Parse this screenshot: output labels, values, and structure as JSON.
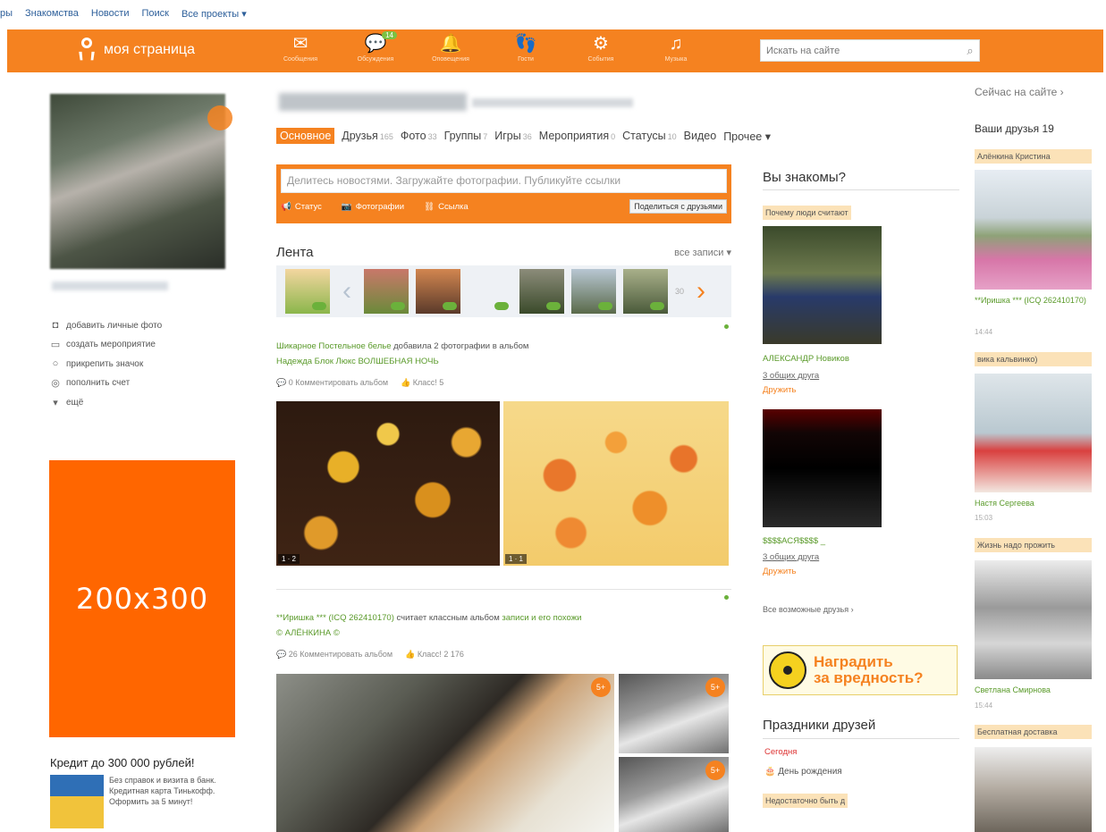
{
  "toplinks": [
    "ры",
    "Знакомства",
    "Новости",
    "Поиск",
    "Все проекты ▾"
  ],
  "header": {
    "logo_text": "моя страница",
    "nav": [
      {
        "icon": "envelope-icon",
        "glyph": "✉",
        "label": "Сообщения",
        "badge": ""
      },
      {
        "icon": "discussions-icon",
        "glyph": "💬",
        "label": "Обсуждения",
        "badge": "14"
      },
      {
        "icon": "bell-icon",
        "glyph": "🔔",
        "label": "Оповещения",
        "badge": ""
      },
      {
        "icon": "guests-icon",
        "glyph": "👣",
        "label": "Гости",
        "badge": ""
      },
      {
        "icon": "events-icon",
        "glyph": "⚙",
        "label": "События",
        "badge": ""
      },
      {
        "icon": "music-icon",
        "glyph": "♫",
        "label": "Музыка",
        "badge": ""
      }
    ],
    "search_placeholder": "Искать на сайте"
  },
  "left": {
    "actions": [
      {
        "icon": "camera-icon",
        "glyph": "◘",
        "label": "добавить личные фото"
      },
      {
        "icon": "calendar-icon",
        "glyph": "▭",
        "label": "создать мероприятие"
      },
      {
        "icon": "badge-icon",
        "glyph": "○",
        "label": "прикрепить значок"
      },
      {
        "icon": "wallet-icon",
        "glyph": "◎",
        "label": "пополнить счет"
      },
      {
        "icon": "chevron-down-icon",
        "glyph": "▾",
        "label": "ещё"
      }
    ],
    "ad_text": "200x300",
    "credit_title": "Кредит до 300 000 рублей!",
    "credit_text": "Без справок и визита в банк. Кредитная карта Тинькофф. Оформить за 5 минут!"
  },
  "tabs": [
    {
      "label": "Основное",
      "count": ""
    },
    {
      "label": "Друзья",
      "count": "165"
    },
    {
      "label": "Фото",
      "count": "33"
    },
    {
      "label": "Группы",
      "count": "7"
    },
    {
      "label": "Игры",
      "count": "36"
    },
    {
      "label": "Мероприятия",
      "count": "0"
    },
    {
      "label": "Статусы",
      "count": "10"
    },
    {
      "label": "Видео",
      "count": ""
    },
    {
      "label": "Прочее ▾",
      "count": ""
    }
  ],
  "share": {
    "placeholder": "Делитесь новостями. Загружайте фотографии. Публикуйте ссылки",
    "actions": [
      "Статус",
      "Фотографии",
      "Ссылка"
    ],
    "button": "Поделиться с друзьями"
  },
  "feed": {
    "title": "Лента",
    "all_label": "все записи ▾",
    "more": "30",
    "post1": {
      "author": "Шикарное Постельное белье",
      "action": " добавила 2 фотографии в альбом",
      "album": "Надежда Блок Люкс ВОЛШЕБНАЯ НОЧЬ",
      "comment": "0 Комментировать альбом",
      "klass": "Класс! 5",
      "photo1_stats": "1 · 2",
      "photo2_stats": "1 · 1"
    },
    "post2": {
      "author": "**Иришка *** (ICQ 262410170)",
      "action": " считает классным альбом ",
      "album": "записи и его похожи",
      "extra": "© АЛЁНКИНА ©",
      "comment": "26 Комментировать альбом",
      "klass": "Класс! 2 176",
      "badge": "5+"
    }
  },
  "known": {
    "title": "Вы знакомы?",
    "why": "Почему люди считают",
    "friends": [
      {
        "name": "АЛЕКСАНДР Новиков",
        "mutual": "3 общих друга",
        "add": "Дружить"
      },
      {
        "name": "$$$$АСЯ$$$$ _",
        "mutual": "3 общих друга",
        "add": "Дружить"
      }
    ],
    "all_possible": "Все возможные друзья ›",
    "award_line1": "Наградить",
    "award_line2": "за вредность?",
    "holidays_title": "Праздники друзей",
    "today": "Сегодня",
    "birthday": "День рождения",
    "not_enough": "Недостаточно быть д"
  },
  "right": {
    "online": "Сейчас на сайте ›",
    "your_friends": "Ваши друзья 19",
    "people": [
      {
        "tag": "Алёнкина Кристина",
        "name": "**Иришка *** (ICQ 262410170)",
        "time": "14:44"
      },
      {
        "tag": "вика кальвинко)",
        "name": "Настя Сергеева",
        "time": "15:03"
      },
      {
        "tag": "Жизнь надо прожить",
        "name": "Светлана Смирнова",
        "time": "15:44"
      },
      {
        "tag": "Бесплатная доставка",
        "name": "",
        "time": ""
      }
    ]
  }
}
